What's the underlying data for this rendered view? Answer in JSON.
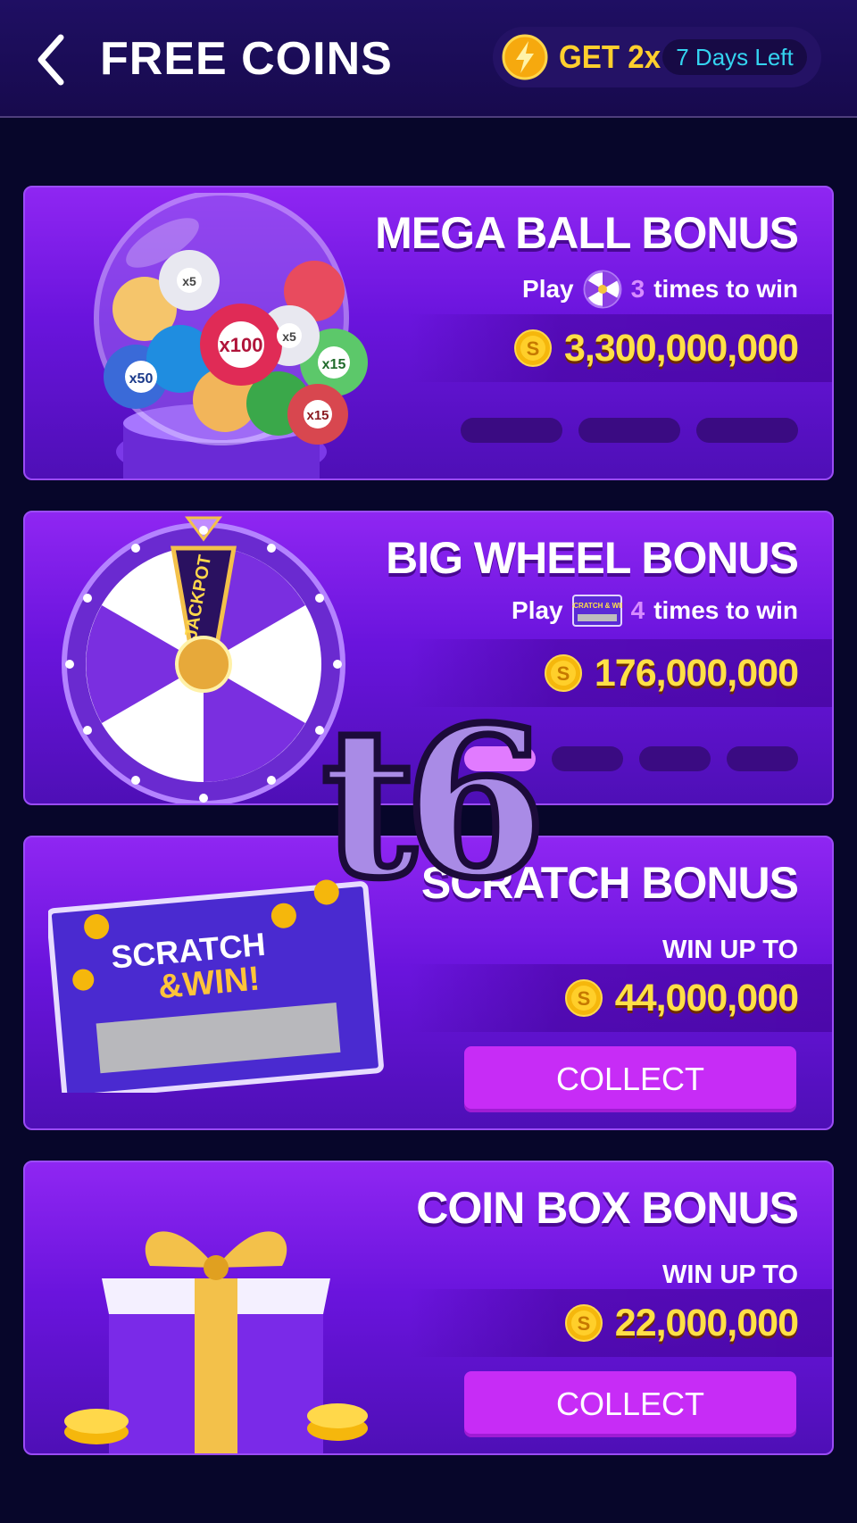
{
  "header": {
    "title": "FREE COINS",
    "boost_label": "GET 2x",
    "days_left": "7 Days Left"
  },
  "cards": [
    {
      "title": "MEGA BALL BONUS",
      "sub_prefix": "Play",
      "sub_count": "3",
      "sub_suffix": "times to win",
      "amount": "3,300,000,000",
      "progress": {
        "done": 0,
        "total": 3
      },
      "ball_labels": [
        "x100",
        "x50",
        "x15",
        "x15",
        "x5",
        "x5"
      ]
    },
    {
      "title": "BIG WHEEL BONUS",
      "sub_prefix": "Play",
      "sub_count": "4",
      "sub_suffix": "times to win",
      "amount": "176,000,000",
      "progress": {
        "done": 1,
        "total": 4
      },
      "wheel_label": "JACKPOT",
      "thumb_label": "SCRATCH & WIN"
    },
    {
      "title": "SCRATCH BONUS",
      "win_label": "WIN UP TO",
      "amount": "44,000,000",
      "button": "COLLECT",
      "ticket_line1": "SCRATCH",
      "ticket_line2": "&WIN!"
    },
    {
      "title": "COIN BOX BONUS",
      "win_label": "WIN UP TO",
      "amount": "22,000,000",
      "button": "COLLECT"
    }
  ],
  "watermark": "t6",
  "colors": {
    "background": "#07062a",
    "card": "#7a1de8",
    "amount": "#ffe047",
    "button": "#c72cf6",
    "days_text": "#34d4f0"
  }
}
